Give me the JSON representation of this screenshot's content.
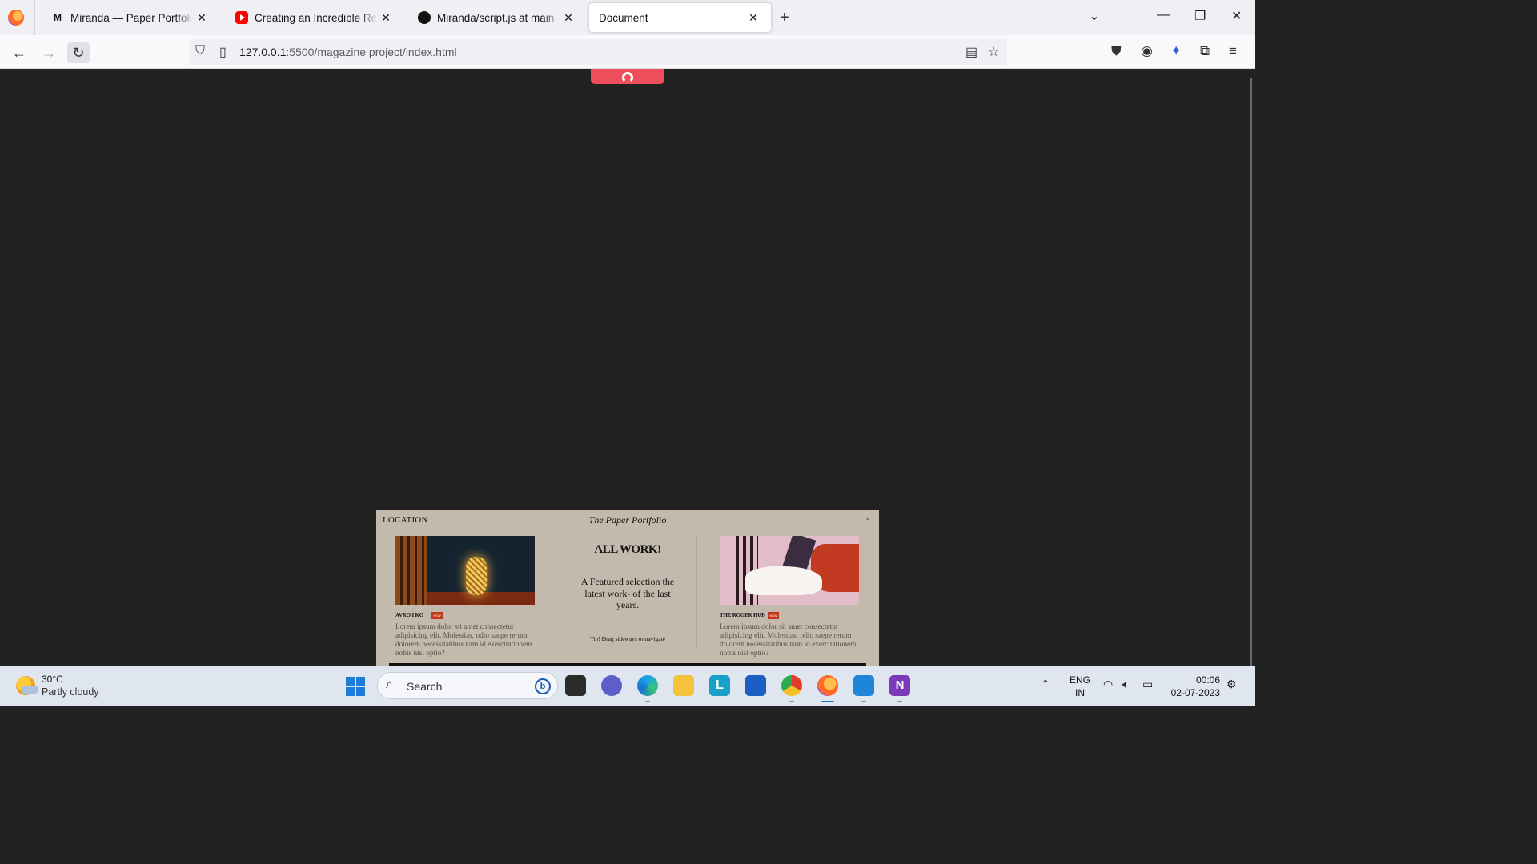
{
  "browser": {
    "tabs": [
      {
        "title": "Miranda — Paper Portfolio",
        "favicon": "medium-icon",
        "active": false
      },
      {
        "title": "Creating an Incredible Retro De",
        "favicon": "youtube-icon",
        "active": false
      },
      {
        "title": "Miranda/script.js at main · shery",
        "favicon": "github-icon",
        "active": false
      },
      {
        "title": "Document",
        "favicon": "",
        "active": true
      }
    ],
    "url_host": "127.0.0.1",
    "url_path": ":5500/magazine project/index.html",
    "new_tab_glyph": "+",
    "close_glyph": "✕"
  },
  "page": {
    "background": "#222222",
    "accent": "#ef4f5c",
    "card": {
      "location": "LOCATION",
      "brand": "The Paper Portfolio",
      "menu_glyph": "≡",
      "left_product": {
        "name": "AVRO I KO",
        "badge": "NEW",
        "description": "Lorem ipsum dolor sit amet consectetur adipisicing elit. Molestias, odio saepe rerum dolorem necessitatibus nam id exercitationem nobis nisi optio?"
      },
      "right_product": {
        "name": "THE ROGER HUB",
        "badge": "NEW",
        "description": "Lorem ipsum dolor sit amet consectetur adipisicing elit. Molestias, odio saepe rerum dolorem necessitatibus nam id exercitationem nobis nisi optio?"
      },
      "center": {
        "title": "ALL WORK!",
        "text": "A Featured selection the latest work- of the last years.",
        "tip": "Tip! Drag sideways to navigate"
      }
    }
  },
  "taskbar": {
    "weather_temp": "30°C",
    "weather_condition": "Partly cloudy",
    "search_placeholder": "Search",
    "bing_glyph": "b",
    "language_line1": "ENG",
    "language_line2": "IN",
    "time": "00:06",
    "date": "02-07-2023"
  }
}
